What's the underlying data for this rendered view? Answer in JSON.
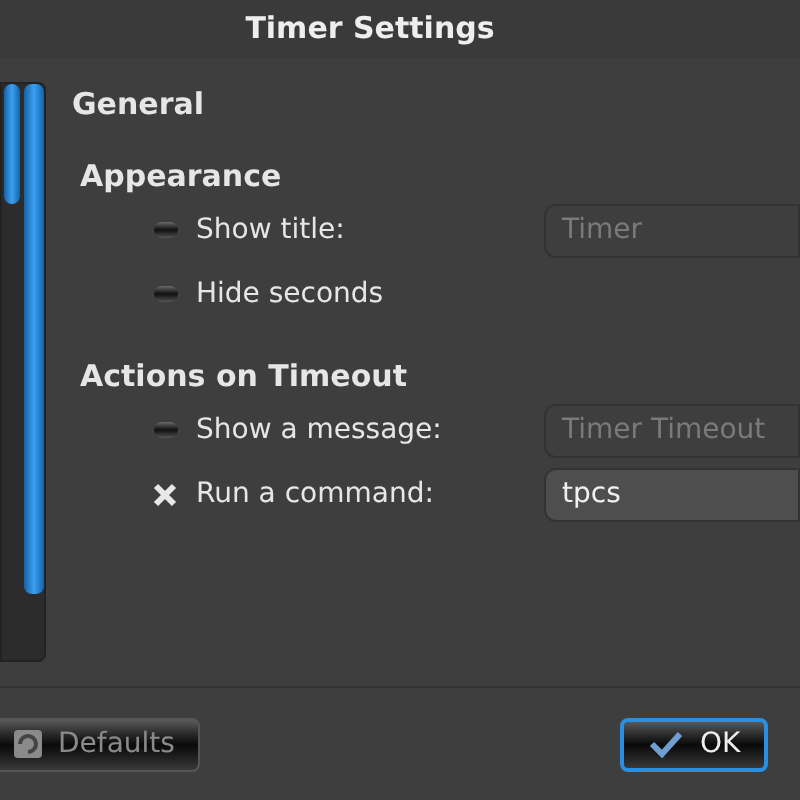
{
  "window": {
    "title": "Timer Settings"
  },
  "page_title": "General",
  "sections": [
    {
      "title": "Appearance",
      "rows": [
        {
          "label": "Show title:",
          "checked": false,
          "field": {
            "value": "Timer",
            "disabled": true
          }
        },
        {
          "label": "Hide seconds",
          "checked": false
        }
      ]
    },
    {
      "title": "Actions on Timeout",
      "rows": [
        {
          "label": "Show a message:",
          "checked": false,
          "field": {
            "value": "Timer Timeout",
            "disabled": true
          }
        },
        {
          "label": "Run a command:",
          "checked": true,
          "field": {
            "value": "tpcs",
            "disabled": false
          }
        }
      ]
    }
  ],
  "buttons": [
    {
      "label": "Defaults",
      "disabled": true,
      "focused": false,
      "kind": "reset"
    },
    {
      "label": "OK",
      "disabled": false,
      "focused": true,
      "kind": "ok"
    }
  ]
}
